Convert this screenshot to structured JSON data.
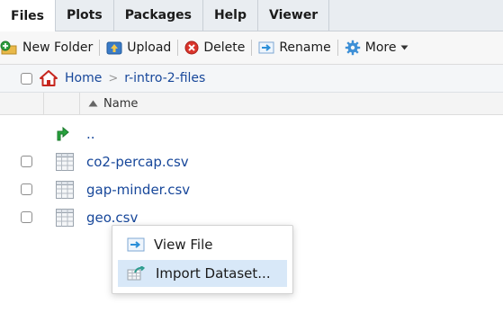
{
  "tabs": [
    {
      "label": "Files",
      "active": true
    },
    {
      "label": "Plots",
      "active": false
    },
    {
      "label": "Packages",
      "active": false
    },
    {
      "label": "Help",
      "active": false
    },
    {
      "label": "Viewer",
      "active": false
    }
  ],
  "toolbar": {
    "new_folder": "New Folder",
    "upload": "Upload",
    "delete": "Delete",
    "rename": "Rename",
    "more": "More"
  },
  "breadcrumb": {
    "home": "Home",
    "folder": "r-intro-2-files"
  },
  "table": {
    "name_header": "Name"
  },
  "files": [
    {
      "name": "..",
      "type": "parent"
    },
    {
      "name": "co2-percap.csv",
      "type": "csv"
    },
    {
      "name": "gap-minder.csv",
      "type": "csv"
    },
    {
      "name": "geo.csv",
      "type": "csv"
    }
  ],
  "context_menu": {
    "items": [
      {
        "label": "View File",
        "icon": "view-file-icon",
        "highlighted": false
      },
      {
        "label": "Import Dataset...",
        "icon": "import-dataset-icon",
        "highlighted": true
      }
    ]
  },
  "colors": {
    "link": "#17479a",
    "highlight": "#d8e8f8",
    "tabbar": "#e9edf1"
  }
}
